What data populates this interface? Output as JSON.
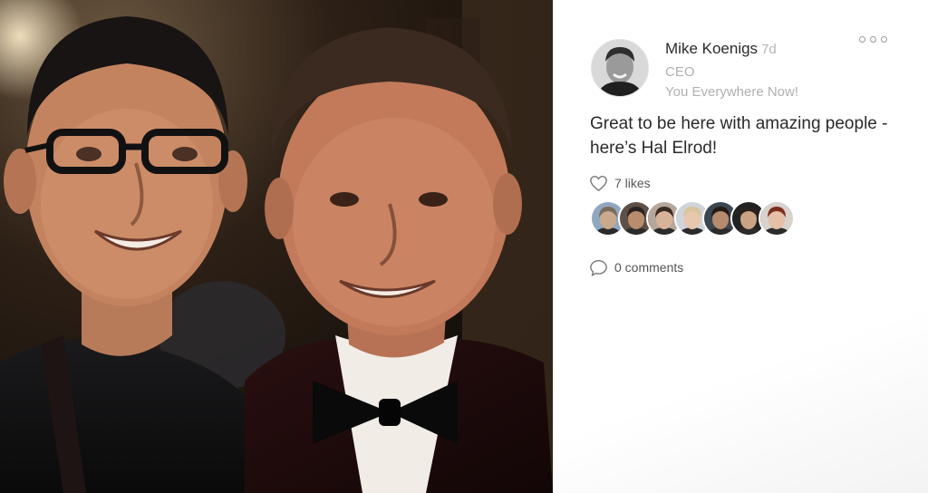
{
  "post": {
    "author_name": "Mike Koenigs",
    "time_ago": "7d",
    "author_title": "CEO",
    "author_company": "You Everywhere Now!",
    "caption": "Great to be here with amazing people - here’s Hal Elrod!",
    "likes_text": "7 likes",
    "comments_text": "0 comments",
    "more_icon": "more-options-icon",
    "like_icon": "heart-icon",
    "comment_icon": "comment-bubble-icon"
  },
  "likers": [
    {
      "skin": "#c9a98c",
      "hair": "#7a6a5a",
      "bg": "#8fa7bf"
    },
    {
      "skin": "#b98d6c",
      "hair": "#2b2320",
      "bg": "#5d5048"
    },
    {
      "skin": "#d8b39a",
      "hair": "#3a2a22",
      "bg": "#b7a79a"
    },
    {
      "skin": "#e7c7ae",
      "hair": "#d9c39a",
      "bg": "#cfd4da"
    },
    {
      "skin": "#b58a6d",
      "hair": "#231a16",
      "bg": "#3c4650"
    },
    {
      "skin": "#caa284",
      "hair": "#2a201c",
      "bg": "#222222"
    },
    {
      "skin": "#e4c0a6",
      "hair": "#7b2f1f",
      "bg": "#d9d2cc"
    }
  ]
}
